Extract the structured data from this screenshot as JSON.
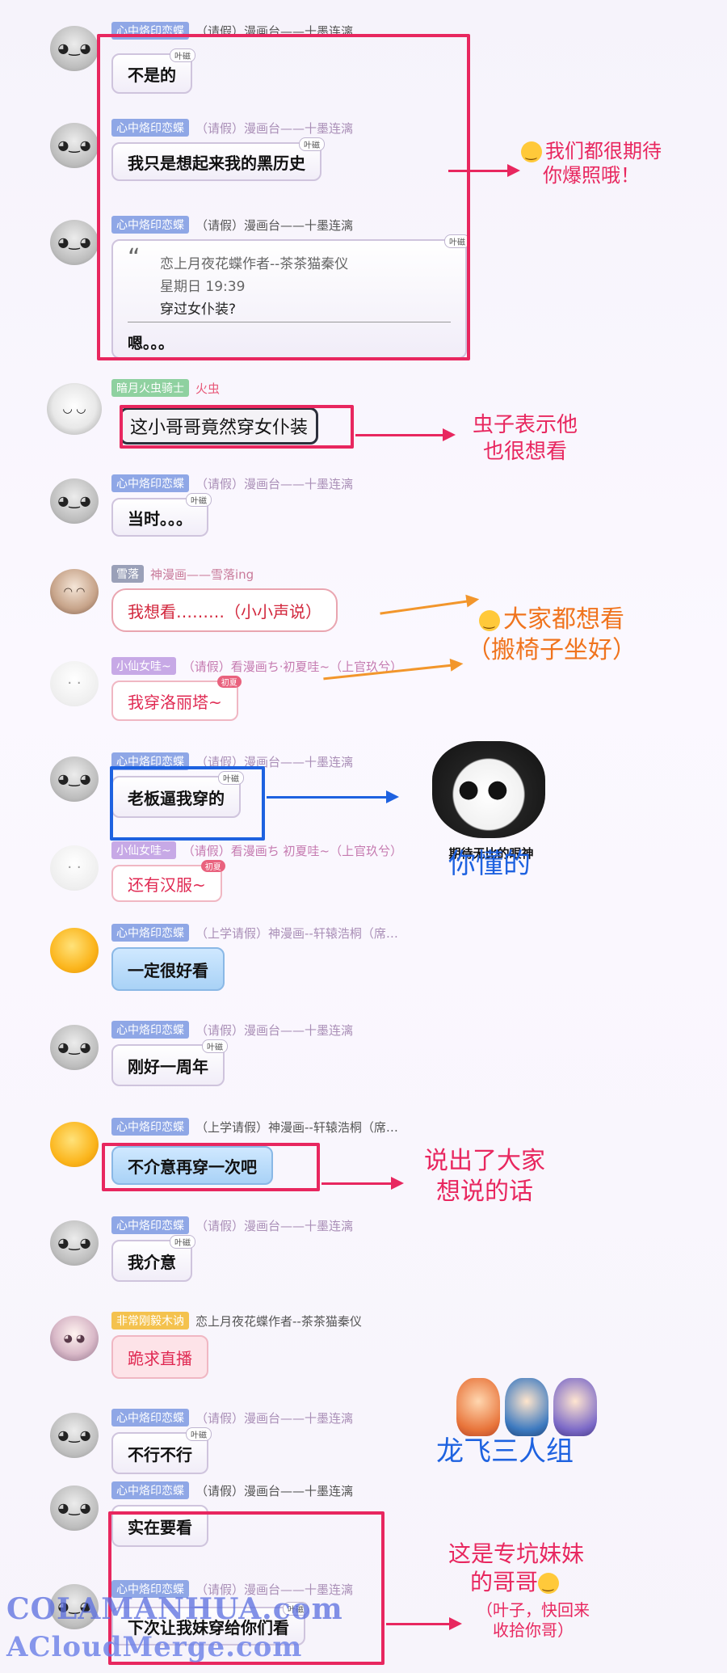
{
  "messages": [
    {
      "name": "心中烙印恋蝶",
      "title": "（请假）漫画台——十墨连漓",
      "text": "不是的",
      "badge": "叶磁"
    },
    {
      "name": "心中烙印恋蝶",
      "title": "（请假）漫画台——十墨连漓",
      "text": "我只是想起来我的黑历史",
      "badge": "叶磁"
    },
    {
      "name": "心中烙印恋蝶",
      "title": "（请假）漫画台——十墨连漓",
      "badge": "叶磁",
      "quote": {
        "author": "恋上月夜花蝶作者--茶茶猫秦仪",
        "time": "星期日 19:39",
        "text": "穿过女仆装?"
      },
      "text": "嗯。。。"
    },
    {
      "name": "暗月火虫骑士",
      "title": "火虫",
      "text": "这小哥哥竟然穿女仆装"
    },
    {
      "name": "心中烙印恋蝶",
      "title": "（请假）漫画台——十墨连漓",
      "text": "当时。。。",
      "badge": "叶磁"
    },
    {
      "name": "雪落",
      "title": "神漫画——雪落ing",
      "text": "我想看………（小小声说）"
    },
    {
      "name": "小仙女哇~",
      "title": "（请假）看漫画ち·初夏哇~（上官玖兮）",
      "text": "我穿洛丽塔~",
      "badge": "初夏"
    },
    {
      "name": "心中烙印恋蝶",
      "title": "（请假）漫画台——十墨连漓",
      "text": "老板逼我穿的",
      "badge": "叶磁"
    },
    {
      "name": "小仙女哇~",
      "title": "（请假）看漫画ち 初夏哇~（上官玖兮）",
      "text": "还有汉服~",
      "badge": "初夏"
    },
    {
      "name": "心中烙印恋蝶",
      "title": "（上学请假）神漫画--轩辕浩桐（席…",
      "text": "一定很好看"
    },
    {
      "name": "心中烙印恋蝶",
      "title": "（请假）漫画台——十墨连漓",
      "text": "刚好一周年",
      "badge": "叶磁"
    },
    {
      "name": "心中烙印恋蝶",
      "title": "（上学请假）神漫画--轩辕浩桐（席…",
      "text": "不介意再穿一次吧"
    },
    {
      "name": "心中烙印恋蝶",
      "title": "（请假）漫画台——十墨连漓",
      "text": "我介意",
      "badge": "叶磁"
    },
    {
      "name": "非常刚毅木讷",
      "title": "恋上月夜花蝶作者--茶茶猫秦仪",
      "text": "跪求直播"
    },
    {
      "name": "心中烙印恋蝶",
      "title": "（请假）漫画台——十墨连漓",
      "text": "不行不行",
      "badge": "叶磁"
    },
    {
      "name": "心中烙印恋蝶",
      "title": "（请假）漫画台——十墨连漓",
      "text": "实在要看"
    },
    {
      "name": "心中烙印恋蝶",
      "title": "（请假）漫画台——十墨连漓",
      "text": "下次让我妹穿给你们看",
      "badge": "叶磁"
    }
  ],
  "annotations": {
    "a1": "我们都很期待",
    "a1b": "你爆照哦！",
    "a2": "虫子表示他",
    "a2b": "也很想看",
    "a3": "大家都想看",
    "a3b": "（搬椅子坐好）",
    "a4": "期待无比的眼神",
    "a4b": "你懂的",
    "a5": "说出了大家",
    "a5b": "想说的话",
    "a6": "龙飞三人组",
    "a7": "这是专坑妹妹",
    "a7b": "的哥哥",
    "a7c": "（叶子，快回来",
    "a7d": "收拾你哥）"
  },
  "watermark": {
    "line1": "COLAMANHUA.com",
    "line2": "ACloudMerge.com"
  },
  "colors": {
    "highlight": "#e8275f",
    "blue": "#1e62e0",
    "orange": "#f0741e"
  }
}
